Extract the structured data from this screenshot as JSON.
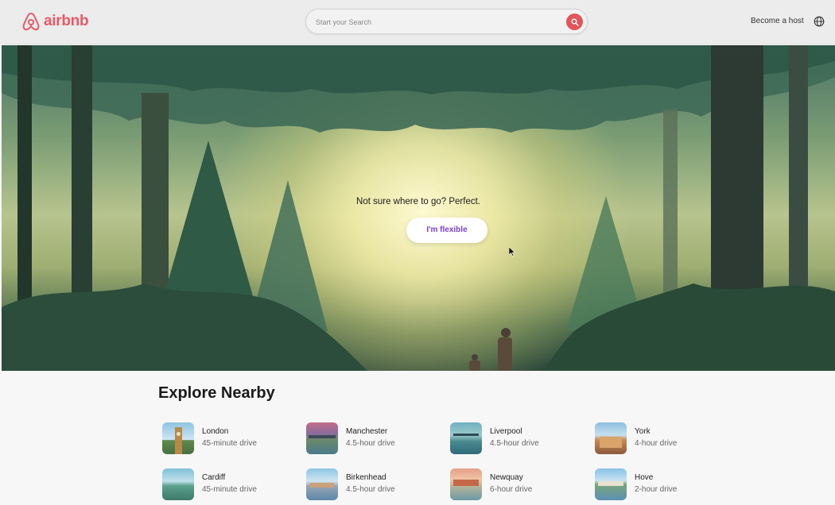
{
  "header": {
    "logo_text": "airbnb",
    "search_placeholder": "Start your Search",
    "become_host": "Become a host",
    "icons": {
      "logo": "airbnb-logo-icon",
      "search": "search-icon",
      "globe": "globe-icon"
    }
  },
  "hero": {
    "headline": "Not sure where to go? Perfect.",
    "button_label": "I'm flexible"
  },
  "explore": {
    "title": "Explore Nearby",
    "places": [
      {
        "name": "London",
        "distance": "45-minute drive"
      },
      {
        "name": "Manchester",
        "distance": "4.5-hour drive"
      },
      {
        "name": "Liverpool",
        "distance": "4.5-hour drive"
      },
      {
        "name": "York",
        "distance": "4-hour drive"
      },
      {
        "name": "Cardiff",
        "distance": "45-minute drive"
      },
      {
        "name": "Birkenhead",
        "distance": "4.5-hour drive"
      },
      {
        "name": "Newquay",
        "distance": "6-hour drive"
      },
      {
        "name": "Hove",
        "distance": "2-hour drive"
      }
    ]
  },
  "colors": {
    "brand": "#e85a66",
    "flexible_text": "#7c3fd6",
    "search_button": "#e0565b"
  }
}
